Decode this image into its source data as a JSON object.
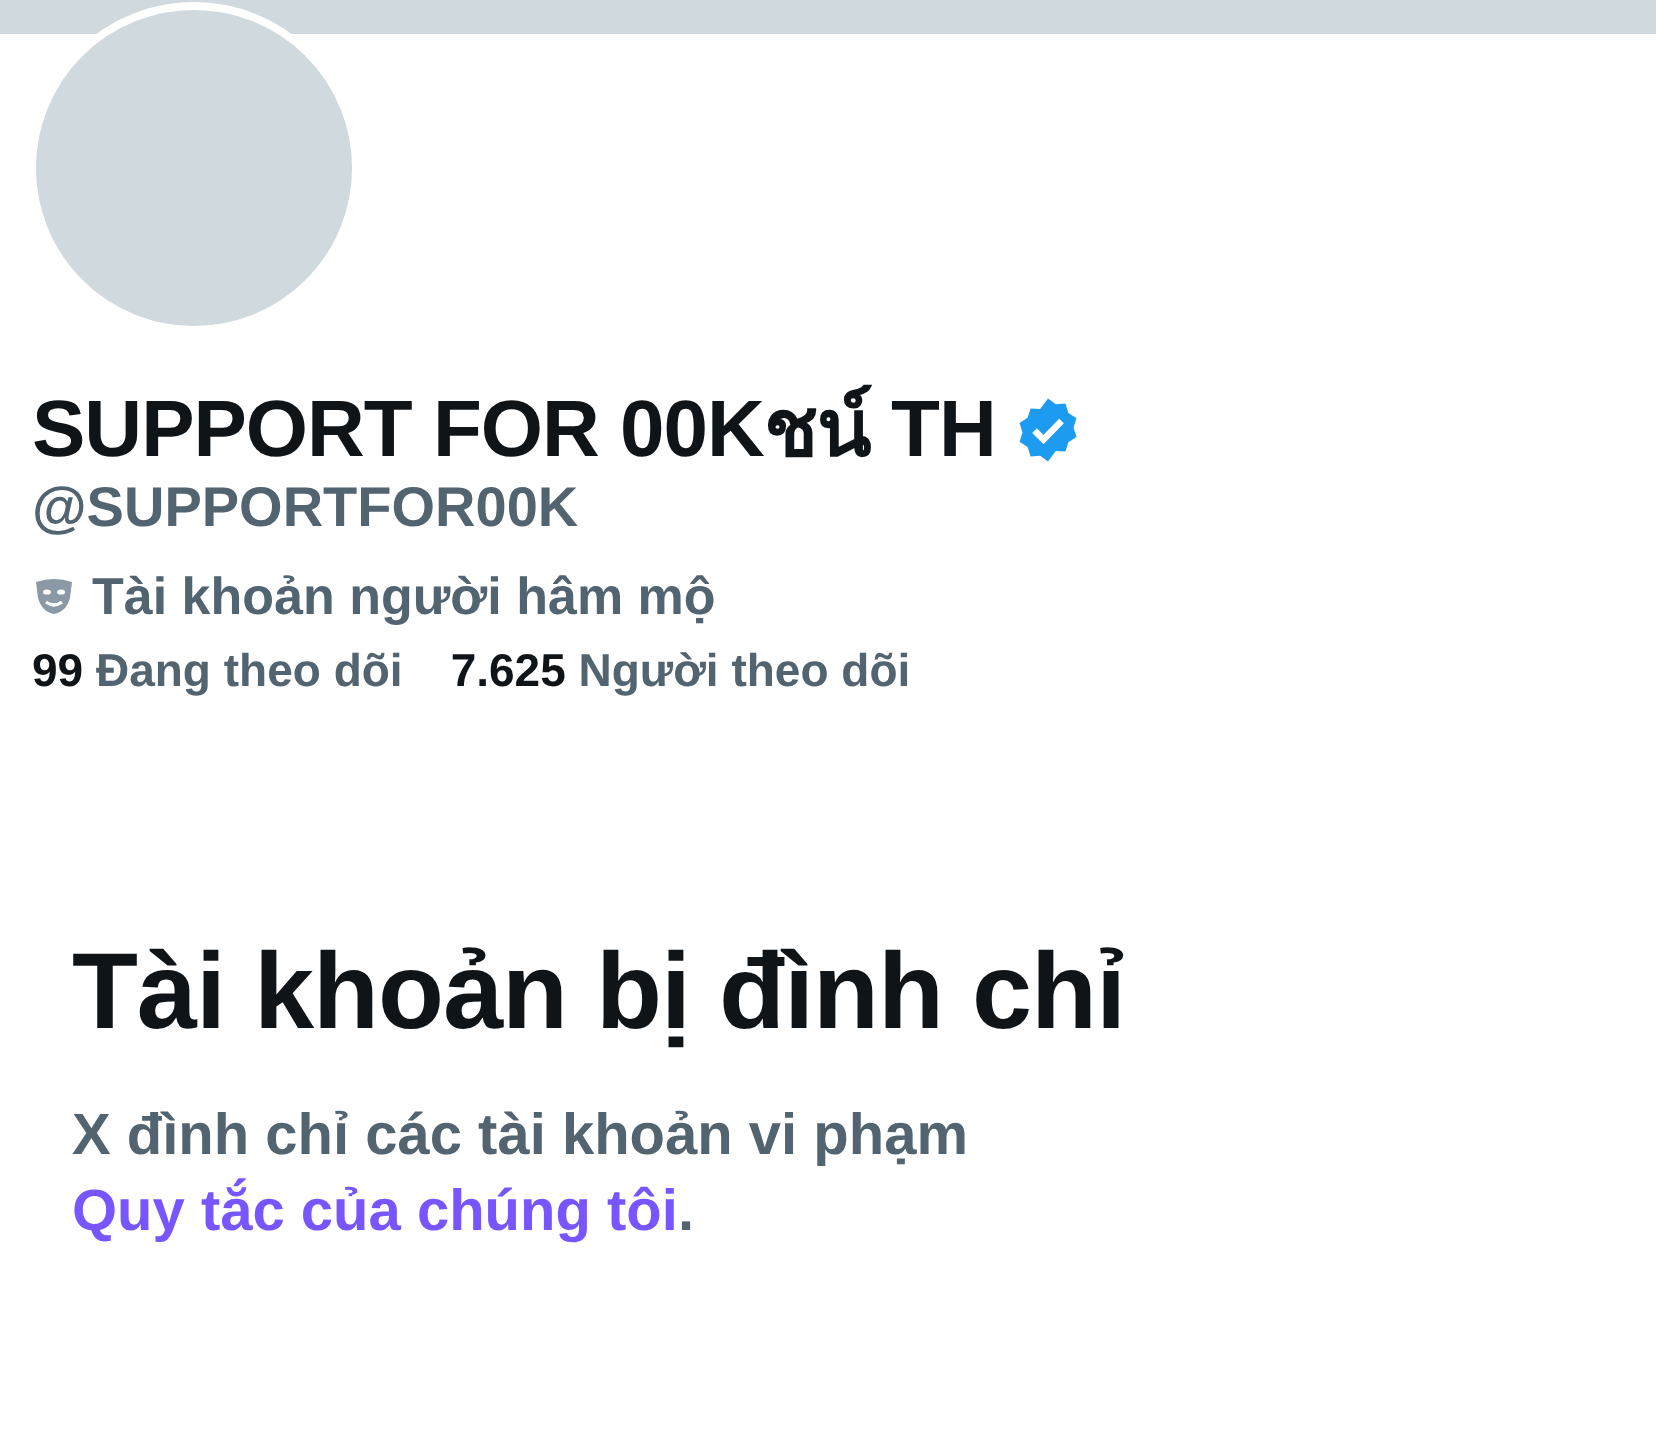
{
  "profile": {
    "name": "SUPPORT FOR 00Kชน์ TH",
    "verified": true,
    "handle": "@SUPPORTFOR00K",
    "account_label": "Tài khoản người hâm mộ",
    "stats": [
      {
        "count": "99",
        "label": "Đang theo dõi"
      },
      {
        "count": "7.625",
        "label": "Người theo dõi"
      }
    ]
  },
  "suspension": {
    "title": "Tài khoản bị đình chỉ",
    "text": "X đình chỉ các tài khoản vi phạm",
    "link": "Quy tắc của chúng tôi",
    "end": "."
  }
}
